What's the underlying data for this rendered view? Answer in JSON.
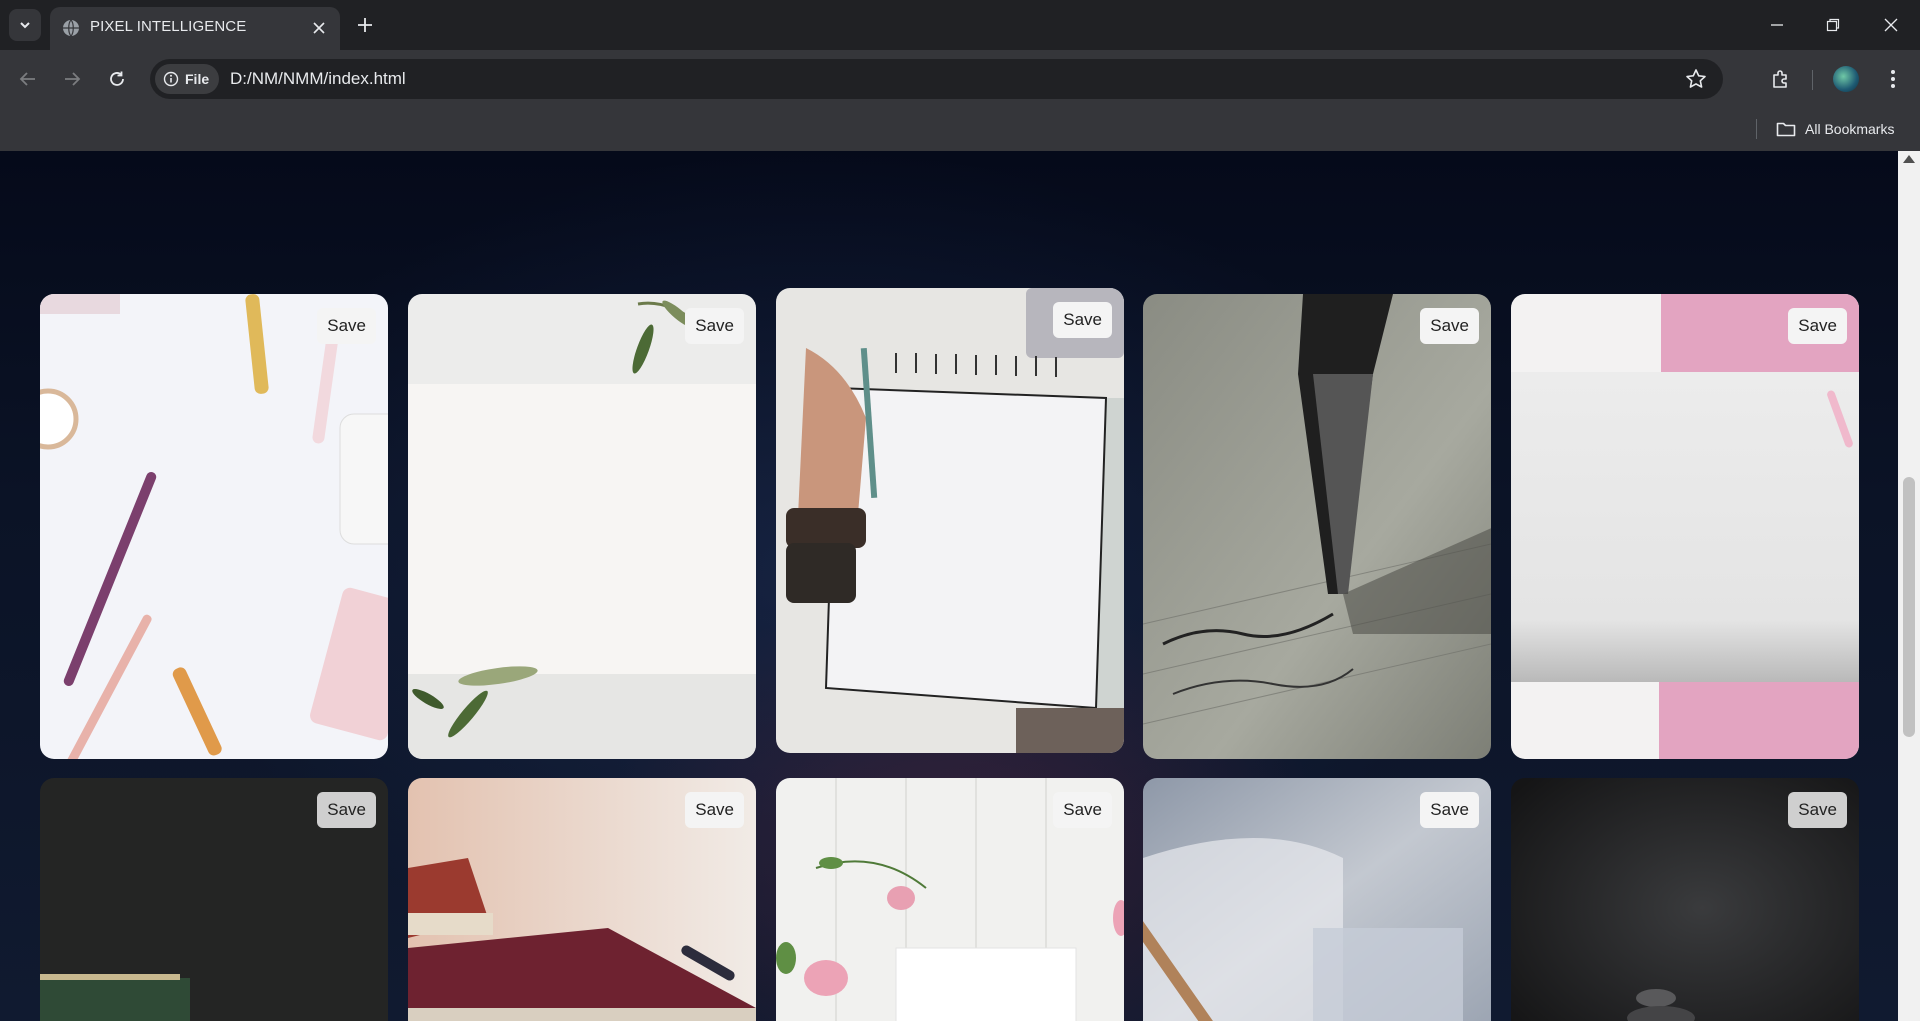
{
  "browser": {
    "tab_title": "PIXEL INTELLIGENCE",
    "url": "D:/NM/NMM/index.html",
    "site_chip_label": "File",
    "bookmarks_label": "All Bookmarks"
  },
  "gallery": {
    "save_label": "Save",
    "cards": [
      {
        "id": "stationery-pens-flatlay"
      },
      {
        "id": "blank-paper-olive-leaves"
      },
      {
        "id": "hand-with-sketchbook"
      },
      {
        "id": "fountain-pen-writing"
      },
      {
        "id": "pink-frame-mockup"
      },
      {
        "id": "dark-chalkboard-books"
      },
      {
        "id": "stacked-books-pen"
      },
      {
        "id": "roses-white-wood"
      },
      {
        "id": "blurred-notebook-pencil"
      },
      {
        "id": "dark-stones"
      }
    ]
  }
}
